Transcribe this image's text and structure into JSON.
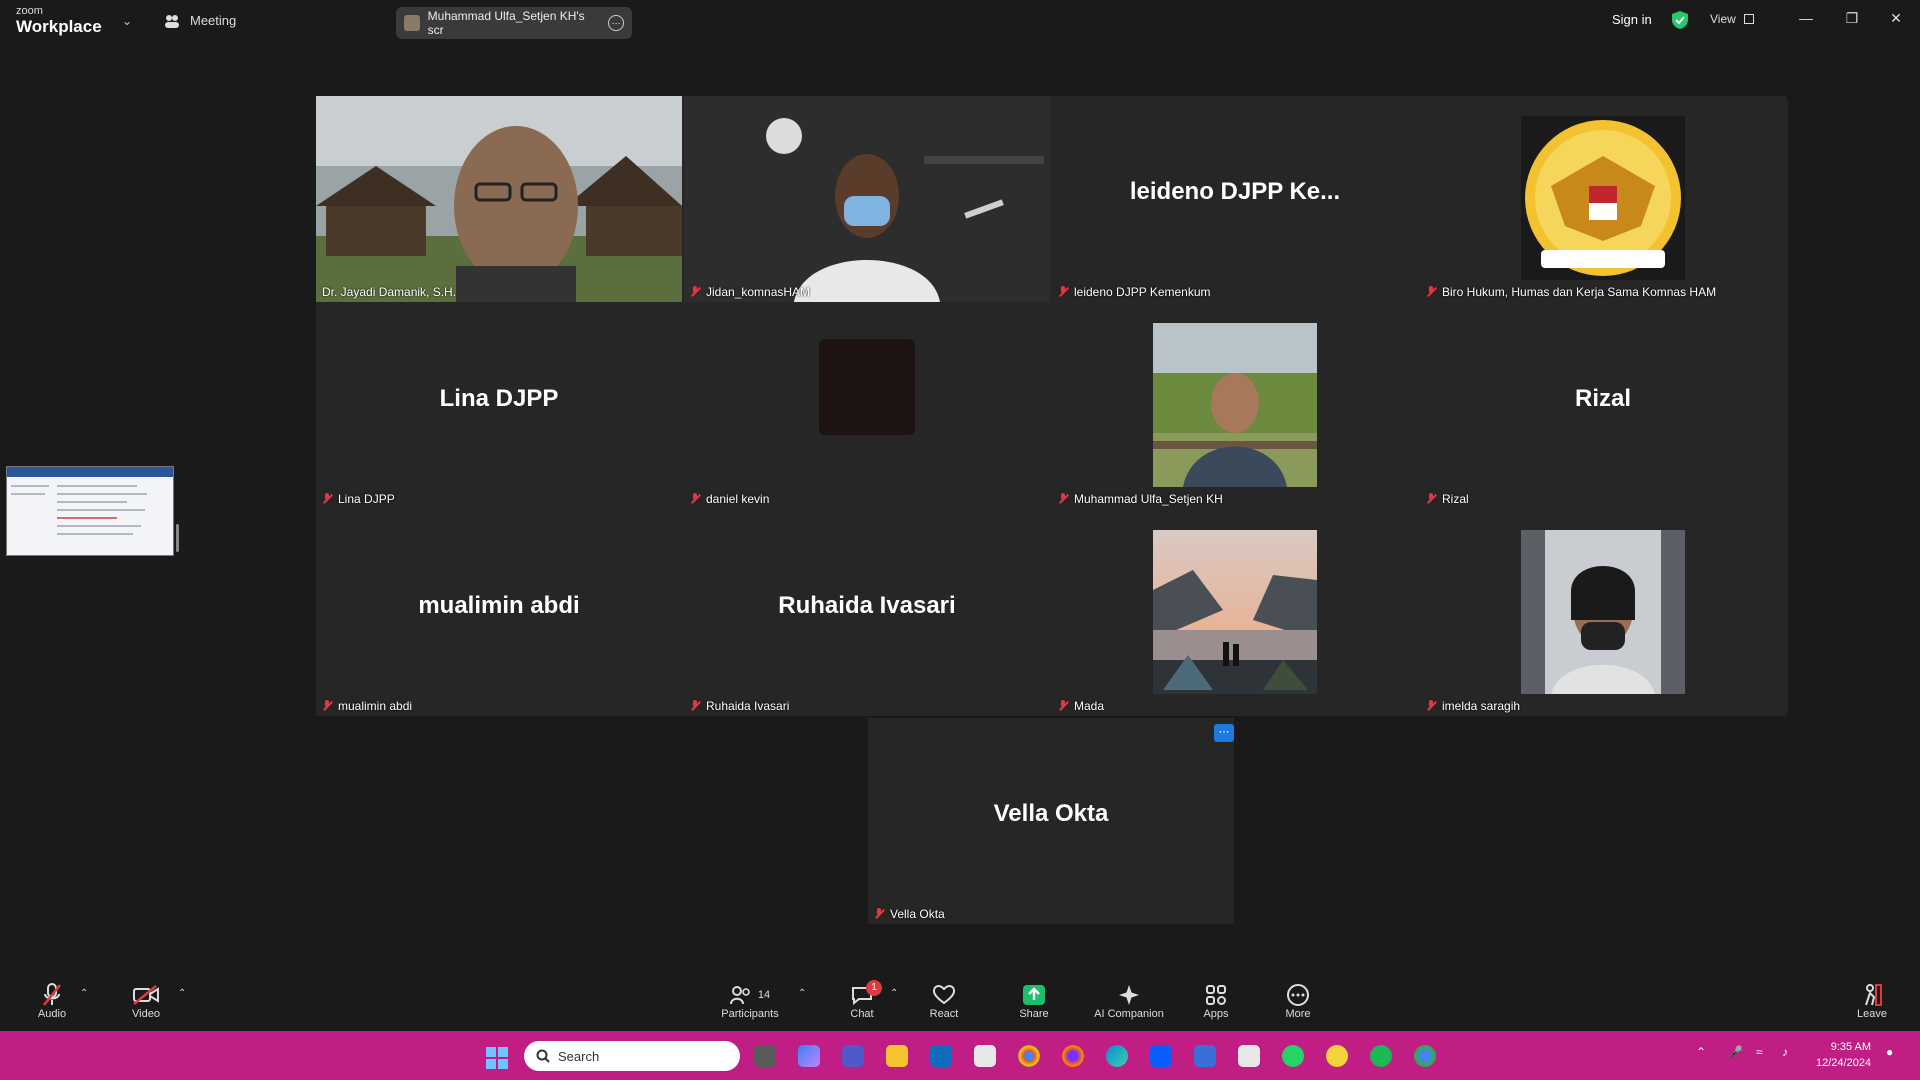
{
  "titlebar": {
    "logo_top": "zoom",
    "logo_bottom": "Workplace",
    "meeting_label": "Meeting",
    "share_label": "Muhammad Ulfa_Setjen KH's scr",
    "signin": "Sign in",
    "view": "View"
  },
  "tiles": [
    {
      "name": "Dr. Jayadi Damanik, S.H.",
      "video": true,
      "active": true
    },
    {
      "name": "Jidan_komnasHAM",
      "video": true
    },
    {
      "name": "leideno DJPP Kemenkum",
      "big": "leideno DJPP Ke..."
    },
    {
      "name": "Biro Hukum, Humas dan Kerja Sama Komnas HAM",
      "logo": "KOMNAS HAM RI"
    },
    {
      "name": "Lina DJPP",
      "big": "Lina DJPP"
    },
    {
      "name": "daniel kevin"
    },
    {
      "name": "Muhammad Ulfa_Setjen KH"
    },
    {
      "name": "Rizal",
      "big": "Rizal"
    },
    {
      "name": "mualimin abdi",
      "big": "mualimin abdi"
    },
    {
      "name": "Ruhaida Ivasari",
      "big": "Ruhaida Ivasari"
    },
    {
      "name": "Mada"
    },
    {
      "name": "imelda saragih"
    },
    {
      "name": "Vella Okta",
      "big": "Vella Okta"
    }
  ],
  "toolbar": {
    "audio": "Audio",
    "video": "Video",
    "participants": "Participants",
    "participants_count": "14",
    "chat": "Chat",
    "chat_badge": "1",
    "react": "React",
    "share": "Share",
    "ai": "AI Companion",
    "apps": "Apps",
    "more": "More",
    "leave": "Leave"
  },
  "taskbar": {
    "search_placeholder": "Search",
    "time": "9:35 AM",
    "date": "12/24/2024"
  },
  "colors": {
    "accent_green": "#2ac66b",
    "taskbar": "#c01e84",
    "share_green": "#1fbf6a",
    "muted_red": "#e0393e"
  }
}
